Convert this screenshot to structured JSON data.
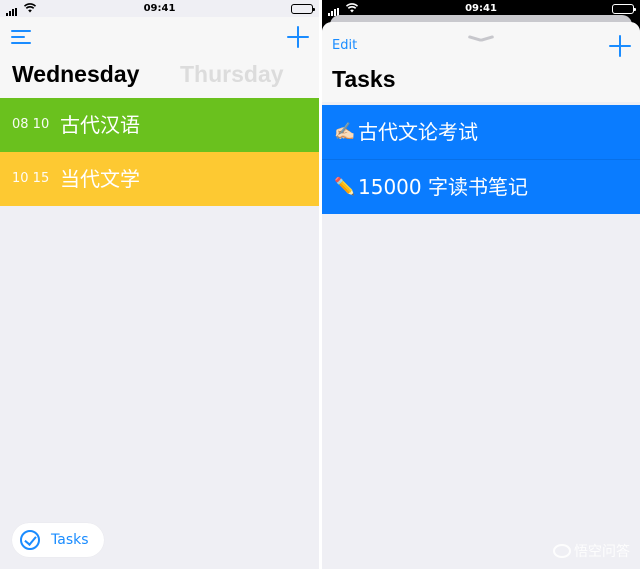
{
  "left": {
    "status": {
      "time": "09:41"
    },
    "header": {
      "menu_icon": "hamburger-icon",
      "add_icon": "plus-icon"
    },
    "days": {
      "current": "Wednesday",
      "next": "Thursday"
    },
    "events": [
      {
        "time": "08 10",
        "title": "古代汉语",
        "color": "#6ac11e"
      },
      {
        "time": "10 15",
        "title": "当代文学",
        "color": "#fdc932"
      }
    ],
    "tasks_button": {
      "label": "Tasks",
      "icon": "checkmark-circle-icon"
    }
  },
  "right": {
    "status": {
      "time": "09:41"
    },
    "header": {
      "edit_label": "Edit",
      "grabber_icon": "chevron-down-icon",
      "add_icon": "plus-icon",
      "title": "Tasks"
    },
    "tasks": [
      {
        "icon": "✍🏻",
        "icon_name": "writing-hand-icon",
        "title": "古代文论考试"
      },
      {
        "icon": "✏️",
        "icon_name": "pencil-icon",
        "title": "15000 字读书笔记"
      }
    ]
  },
  "watermark": {
    "text": "悟空问答"
  },
  "colors": {
    "accent": "#1a8cff",
    "task_blue": "#0a7cff",
    "event_green": "#6ac11e",
    "event_yellow": "#fdc932"
  }
}
